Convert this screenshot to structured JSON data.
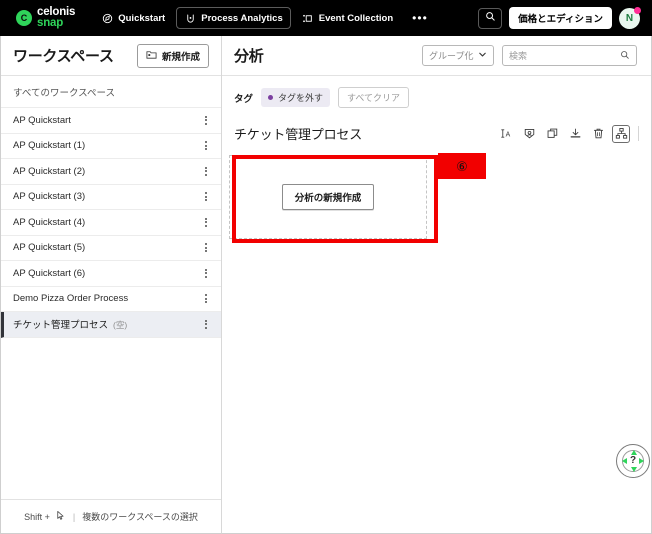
{
  "topnav": {
    "logo": {
      "line1": "celonis",
      "line2": "snap",
      "mark": "C"
    },
    "items": [
      {
        "label": "Quickstart",
        "icon": "compass-icon",
        "active": false
      },
      {
        "label": "Process Analytics",
        "icon": "analytics-icon",
        "active": true
      },
      {
        "label": "Event Collection",
        "icon": "event-collection-icon",
        "active": false
      }
    ],
    "more_label": "•••",
    "search_icon": "search-icon",
    "pricing_label": "価格とエディション",
    "avatar_initial": "N"
  },
  "sidebar": {
    "title": "ワークスペース",
    "new_button": "新規作成",
    "all_label": "すべてのワークスペース",
    "items": [
      {
        "label": "AP Quickstart",
        "sub": "",
        "selected": false
      },
      {
        "label": "AP Quickstart (1)",
        "sub": "",
        "selected": false
      },
      {
        "label": "AP Quickstart (2)",
        "sub": "",
        "selected": false
      },
      {
        "label": "AP Quickstart (3)",
        "sub": "",
        "selected": false
      },
      {
        "label": "AP Quickstart (4)",
        "sub": "",
        "selected": false
      },
      {
        "label": "AP Quickstart (5)",
        "sub": "",
        "selected": false
      },
      {
        "label": "AP Quickstart (6)",
        "sub": "",
        "selected": false
      },
      {
        "label": "Demo Pizza Order Process",
        "sub": "",
        "selected": false
      },
      {
        "label": "チケット管理プロセス",
        "sub": "(空)",
        "selected": true
      }
    ],
    "footer": {
      "shift_label": "Shift +",
      "cursor_icon": "cursor-icon",
      "separator": "|",
      "hint": "複数のワークスペースの選択"
    }
  },
  "main": {
    "title": "分析",
    "groupby": {
      "label": "グループ化",
      "chevron": "chevron-down-icon"
    },
    "search": {
      "value": "",
      "placeholder": "検索",
      "icon": "search-icon"
    },
    "tags": {
      "label": "タグ",
      "chip": "タグを外す",
      "chip_dot_color": "#7b3fa0",
      "clear": "すべてクリア"
    },
    "process": {
      "name": "チケット管理プロセス",
      "tools": [
        {
          "name": "rename-icon",
          "label": "IA",
          "boxed": false
        },
        {
          "name": "permissions-icon",
          "label": "",
          "boxed": false
        },
        {
          "name": "duplicate-icon",
          "label": "",
          "boxed": false
        },
        {
          "name": "download-icon",
          "label": "",
          "boxed": false
        },
        {
          "name": "delete-icon",
          "label": "",
          "boxed": false
        },
        {
          "name": "hierarchy-icon",
          "label": "",
          "boxed": true
        }
      ]
    },
    "dropzone": {
      "new_analysis_button": "分析の新規作成"
    }
  },
  "annotation": {
    "badge": "⑥",
    "color": "#f20000"
  },
  "help": {
    "icon": "help-icon",
    "symbol": "?",
    "accent": "#2fd45a"
  }
}
